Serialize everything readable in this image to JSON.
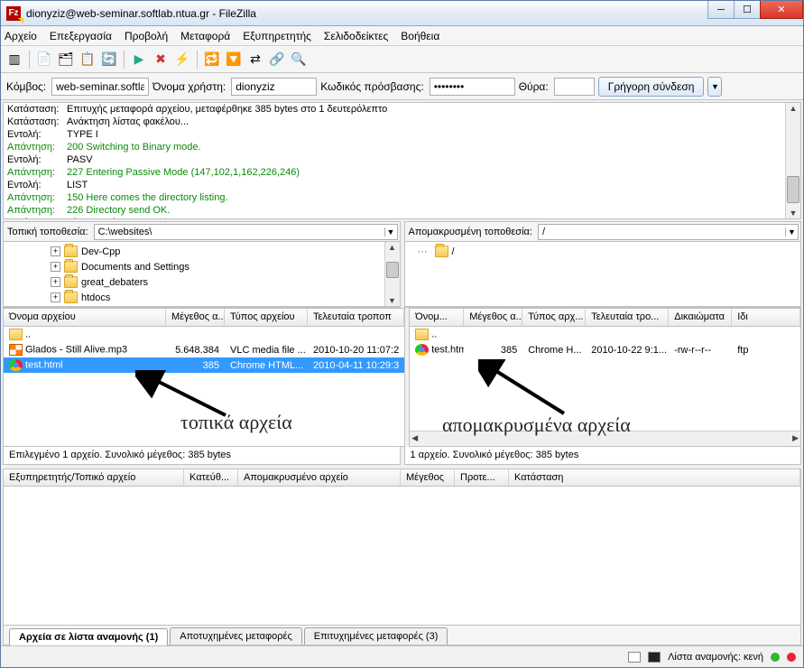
{
  "window": {
    "title": "dionyziz@web-seminar.softlab.ntua.gr - FileZilla",
    "app_icon_text": "Fz"
  },
  "menu": {
    "file": "Αρχείο",
    "edit": "Επεξεργασία",
    "view": "Προβολή",
    "transfer": "Μεταφορά",
    "server": "Εξυπηρετητής",
    "bookmarks": "Σελιδοδείκτες",
    "help": "Βοήθεια"
  },
  "quickconnect": {
    "host_label": "Κόμβος:",
    "host": "web-seminar.softlab.",
    "user_label": "Όνομα χρήστη:",
    "user": "dionyziz",
    "pass_label": "Κωδικός πρόσβασης:",
    "pass": "••••••••",
    "port_label": "Θύρα:",
    "port": "",
    "button": "Γρήγορη σύνδεση"
  },
  "log": [
    {
      "lbl": "Κατάσταση:",
      "msg": "Επιτυχής μεταφορά αρχείου, μεταφέρθηκε 385 bytes στο 1 δευτερόλεπτο",
      "cls": ""
    },
    {
      "lbl": "Κατάσταση:",
      "msg": "Ανάκτηση λίστας φακέλου...",
      "cls": ""
    },
    {
      "lbl": "Εντολή:",
      "msg": "TYPE I",
      "cls": ""
    },
    {
      "lbl": "Απάντηση:",
      "msg": "200 Switching to Binary mode.",
      "cls": "green"
    },
    {
      "lbl": "Εντολή:",
      "msg": "PASV",
      "cls": ""
    },
    {
      "lbl": "Απάντηση:",
      "msg": "227 Entering Passive Mode (147,102,1,162,226,246)",
      "cls": "green"
    },
    {
      "lbl": "Εντολή:",
      "msg": "LIST",
      "cls": ""
    },
    {
      "lbl": "Απάντηση:",
      "msg": "150 Here comes the directory listing.",
      "cls": "green"
    },
    {
      "lbl": "Απάντηση:",
      "msg": "226 Directory send OK.",
      "cls": "green"
    },
    {
      "lbl": "Κατάσταση:",
      "msg": "Λίστα φακέλου επιτυχής",
      "cls": ""
    }
  ],
  "local": {
    "label": "Τοπική τοποθεσία:",
    "path": "C:\\websites\\",
    "tree": [
      "Dev-Cpp",
      "Documents and Settings",
      "great_debaters",
      "htdocs"
    ],
    "columns": {
      "name": "Όνομα αρχείου",
      "size": "Μέγεθος α...",
      "type": "Τύπος αρχείου",
      "mod": "Τελευταία τροποπ"
    },
    "rows": [
      {
        "name": "..",
        "size": "",
        "type": "",
        "mod": "",
        "icon": "fi-folder"
      },
      {
        "name": "Glados - Still Alive.mp3",
        "size": "5.648.384",
        "type": "VLC media file ...",
        "mod": "2010-10-20 11:07:2",
        "icon": "fi-vlc"
      },
      {
        "name": "test.html",
        "size": "385",
        "type": "Chrome HTML...",
        "mod": "2010-04-11 10:29:3",
        "icon": "fi-chrome",
        "sel": true
      }
    ],
    "status": "Επιλεγμένο 1 αρχείο. Συνολικό μέγεθος: 385 bytes"
  },
  "remote": {
    "label": "Απομακρυσμένη τοποθεσία:",
    "path": "/",
    "root": "/",
    "columns": {
      "name": "Όνομ...",
      "size": "Μέγεθος α...",
      "type": "Τύπος αρχ...",
      "mod": "Τελευταία τρο...",
      "perm": "Δικαιώματα",
      "own": "Ιδι"
    },
    "rows": [
      {
        "name": "..",
        "size": "",
        "type": "",
        "mod": "",
        "perm": "",
        "own": "",
        "icon": "fi-folder"
      },
      {
        "name": "test.html",
        "size": "385",
        "type": "Chrome H...",
        "mod": "2010-10-22 9:1...",
        "perm": "-rw-r--r--",
        "own": "ftp",
        "icon": "fi-chrome"
      }
    ],
    "status": "1 αρχείο. Συνολικό μέγεθος: 385 bytes"
  },
  "queue": {
    "columns": {
      "server": "Εξυπηρετητής/Τοπικό αρχείο",
      "dir": "Κατεύθ...",
      "remote": "Απομακρυσμένο αρχείο",
      "size": "Μέγεθος",
      "prio": "Προτε...",
      "status": "Κατάσταση"
    }
  },
  "tabs": {
    "queued": "Αρχεία σε λίστα αναμονής (1)",
    "failed": "Αποτυχημένες μεταφορές",
    "success": "Επιτυχημένες μεταφορές (3)"
  },
  "bottom": {
    "queue": "Λίστα αναμονής: κενή"
  },
  "annotations": {
    "local": "τοπικά αρχεία",
    "remote": "απομακρυσμένα αρχεία"
  }
}
